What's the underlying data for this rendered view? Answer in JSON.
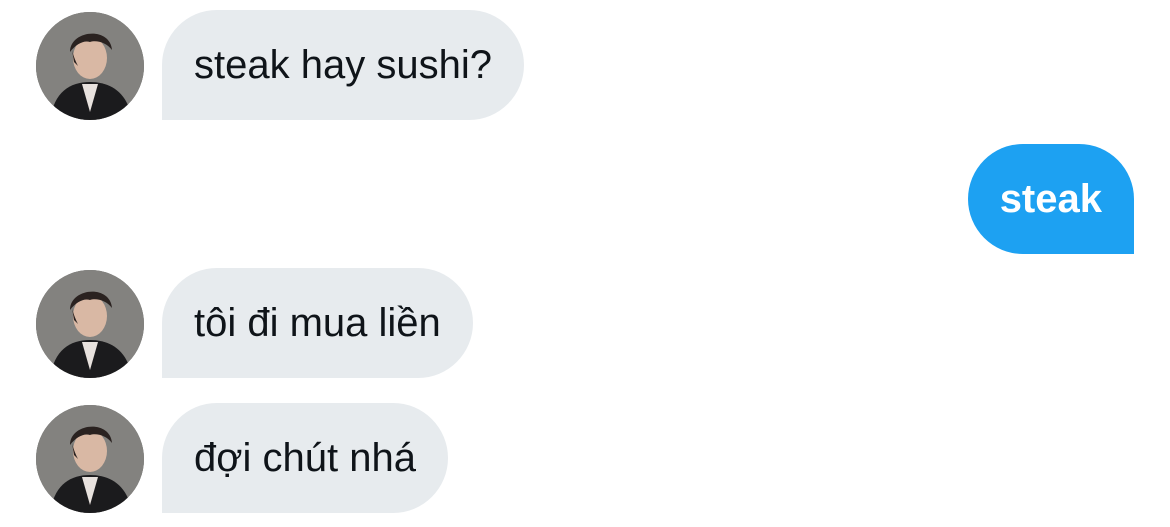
{
  "conversation": {
    "messages": [
      {
        "sender": "them",
        "text": "steak hay sushi?",
        "avatar": "user-photo-avatar"
      },
      {
        "sender": "me",
        "text": "steak"
      },
      {
        "sender": "them",
        "text": "tôi đi mua liền",
        "avatar": "user-photo-avatar"
      },
      {
        "sender": "them",
        "text": "đợi chút nhá",
        "avatar": "user-photo-avatar"
      }
    ]
  },
  "colors": {
    "incoming_bubble": "#e7ebee",
    "outgoing_bubble": "#1da1f2",
    "incoming_text": "#0f1419",
    "outgoing_text": "#ffffff"
  }
}
